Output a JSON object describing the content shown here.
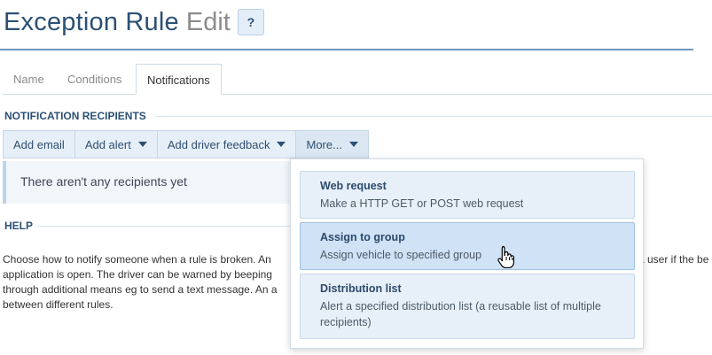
{
  "page": {
    "title_main": "Exception Rule",
    "title_sub": "Edit",
    "help_label": "?"
  },
  "tabs": [
    {
      "label": "Name"
    },
    {
      "label": "Conditions"
    },
    {
      "label": "Notifications"
    }
  ],
  "recipients": {
    "heading": "NOTIFICATION RECIPIENTS",
    "buttons": {
      "add_email": "Add email",
      "add_alert": "Add alert",
      "add_driver_feedback": "Add driver feedback",
      "more": "More..."
    },
    "empty_message": "There aren't any recipients yet"
  },
  "help": {
    "heading": "HELP",
    "text_left": "Choose how to notify someone when a rule is broken. An application is open. The driver can be warned by beeping through additional means eg to send a text message. An a between different rules.",
    "text_right": "a user if the be notified recipients"
  },
  "more_menu": {
    "items": [
      {
        "title": "Web request",
        "description": "Make a HTTP GET or POST web request"
      },
      {
        "title": "Assign to group",
        "description": "Assign vehicle to specified group"
      },
      {
        "title": "Distribution list",
        "description": "Alert a specified distribution list (a reusable list of multiple recipients)"
      }
    ]
  },
  "colors": {
    "title": "#2c5075",
    "accent_border": "#6e98c0",
    "button_bg": "#e6eff8",
    "menu_item_hover": "#cfe2f6"
  }
}
